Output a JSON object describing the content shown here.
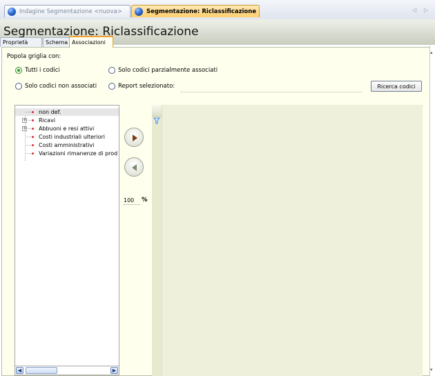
{
  "window": {
    "doc_tabs": [
      {
        "label": "Indagine Segmentazione <nuova>",
        "active": false
      },
      {
        "label": "Segmentazione: Riclassificazione",
        "active": true
      }
    ],
    "nav_arrows": "◁ ▷"
  },
  "header": {
    "title": "Segmentazione: Riclassificazione"
  },
  "tabs": [
    {
      "label": "Proprietà",
      "active": false
    },
    {
      "label": "Schema",
      "active": false
    },
    {
      "label": "Associazioni",
      "active": true
    }
  ],
  "populate": {
    "label": "Popola griglia con:",
    "options": [
      {
        "label": "Tutti i codici",
        "checked": true
      },
      {
        "label": "Solo codici parzialmente associati",
        "checked": false
      },
      {
        "label": "Solo codici non associati",
        "checked": false
      },
      {
        "label": "Report selezionato:",
        "checked": false
      }
    ],
    "report_value": "",
    "search_button": "Ricerca codici"
  },
  "tree": {
    "items": [
      {
        "label": "non def.",
        "expandable": false,
        "selected": true
      },
      {
        "label": "Ricavi",
        "expandable": true,
        "selected": false
      },
      {
        "label": "Abbuoni e resi attivi",
        "expandable": true,
        "selected": false
      },
      {
        "label": "Costi industriali ulteriori",
        "expandable": false,
        "selected": false
      },
      {
        "label": "Costi amministrativi",
        "expandable": false,
        "selected": false
      },
      {
        "label": "Variazioni rimanenze di prod",
        "expandable": false,
        "selected": false
      }
    ]
  },
  "transfer": {
    "percent_value": "100",
    "percent_sign": "%"
  },
  "colors": {
    "panel_bg": "#ffffee",
    "active_tab": "#ffcf6e",
    "tree_dot": "#e0263a",
    "grid_bg": "#eef0dc"
  },
  "icons": {
    "doc_tab_icon": "globe-icon",
    "move_right": "arrow-right-icon",
    "move_left": "arrow-left-icon",
    "grid_filter": "filter-icon"
  }
}
